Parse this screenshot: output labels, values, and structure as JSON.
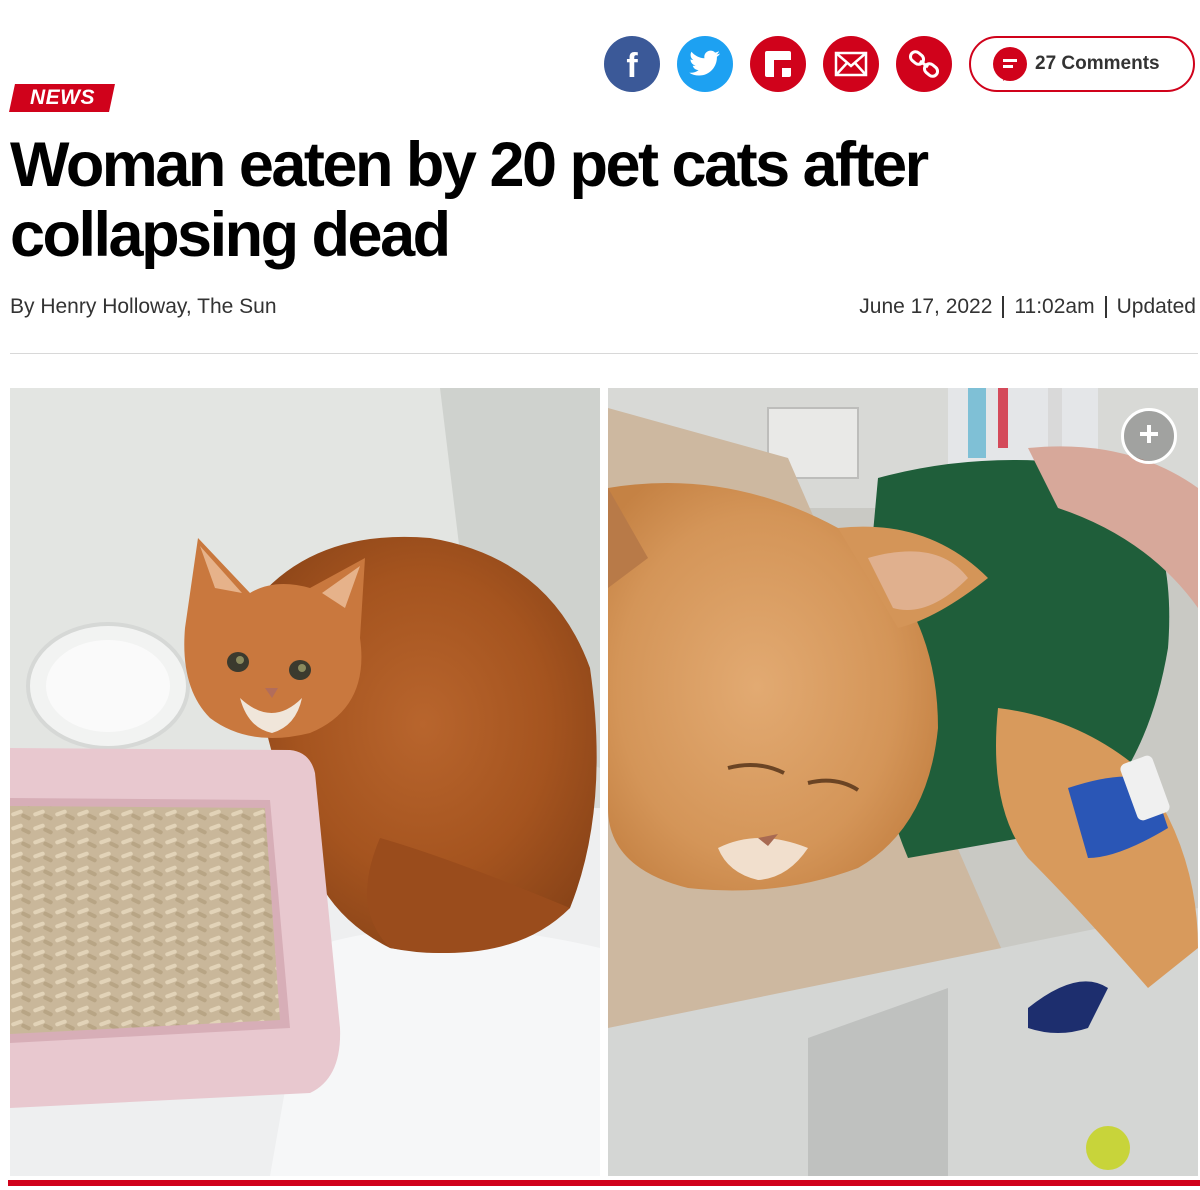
{
  "colors": {
    "accent": "#d0021b",
    "facebook": "#3b5998",
    "twitter": "#1da1f2"
  },
  "share": {
    "buttons": [
      {
        "icon": "facebook-icon"
      },
      {
        "icon": "twitter-icon"
      },
      {
        "icon": "flipboard-icon"
      },
      {
        "icon": "email-icon"
      },
      {
        "icon": "link-icon"
      }
    ],
    "comments_label": "27 Comments"
  },
  "article": {
    "section": "NEWS",
    "headline_line1": "Woman eaten by 20 pet cats after",
    "headline_line2": "collapsing dead",
    "byline": "By Henry Holloway, The Sun",
    "date": "June 17, 2022",
    "time": "11:02am",
    "updated_label": "Updated"
  }
}
